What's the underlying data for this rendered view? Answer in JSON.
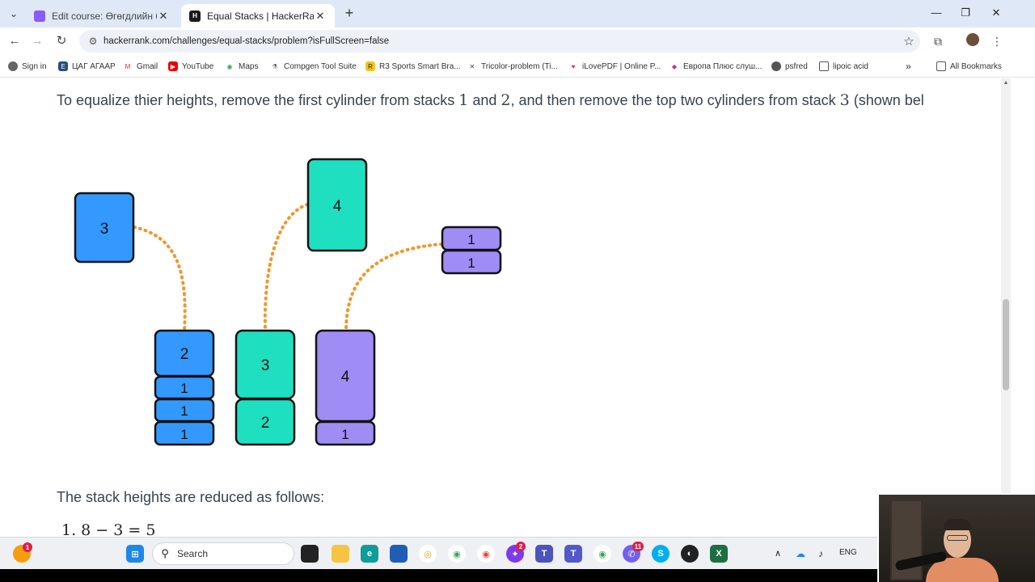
{
  "browser": {
    "tabs": [
      {
        "title": "Edit course: Өгөгдлийн бүтэц б",
        "active": false
      },
      {
        "title": "Equal Stacks | HackerRank",
        "active": true
      }
    ],
    "url": "hackerrank.com/challenges/equal-stacks/problem?isFullScreen=false",
    "bookmarks": [
      "Sign in",
      "ЦАГ АГААР",
      "Gmail",
      "YouTube",
      "Maps",
      "Compgen Tool Suite",
      "R3 Sports Smart Bra...",
      "Tricolor-problem (Ti...",
      "iLovePDF | Online P...",
      "Европа Плюс слуш...",
      "psfred",
      "lipoic acid",
      "All Bookmarks"
    ]
  },
  "page": {
    "para1_a": "To equalize thier heights, remove the first cylinder from stacks ",
    "n1": "1",
    "para1_b": " and ",
    "n2": "2",
    "para1_c": ", and then remove the top two cylinders from stack ",
    "n3": "3",
    "para1_d": " (shown bel",
    "para2": "The stack heights are reduced as follows:",
    "formula": "1. 8 − 3 = 5"
  },
  "diagram": {
    "colors": {
      "blue": "#3399ff",
      "teal": "#1ee0c0",
      "purple": "#a08cf5",
      "dots": "#f0962a"
    },
    "removed": {
      "stack1_top": "3",
      "stack2_top": "4",
      "stack3_top": [
        "1",
        "1"
      ]
    },
    "stacks": [
      [
        "2",
        "1",
        "1",
        "1"
      ],
      [
        "3",
        "2"
      ],
      [
        "4",
        "1"
      ]
    ]
  },
  "taskbar": {
    "search_placeholder": "Search",
    "lang": "ENG",
    "notifications": {
      "teams_chat": "2",
      "viber": "11",
      "firefox": "1"
    }
  }
}
